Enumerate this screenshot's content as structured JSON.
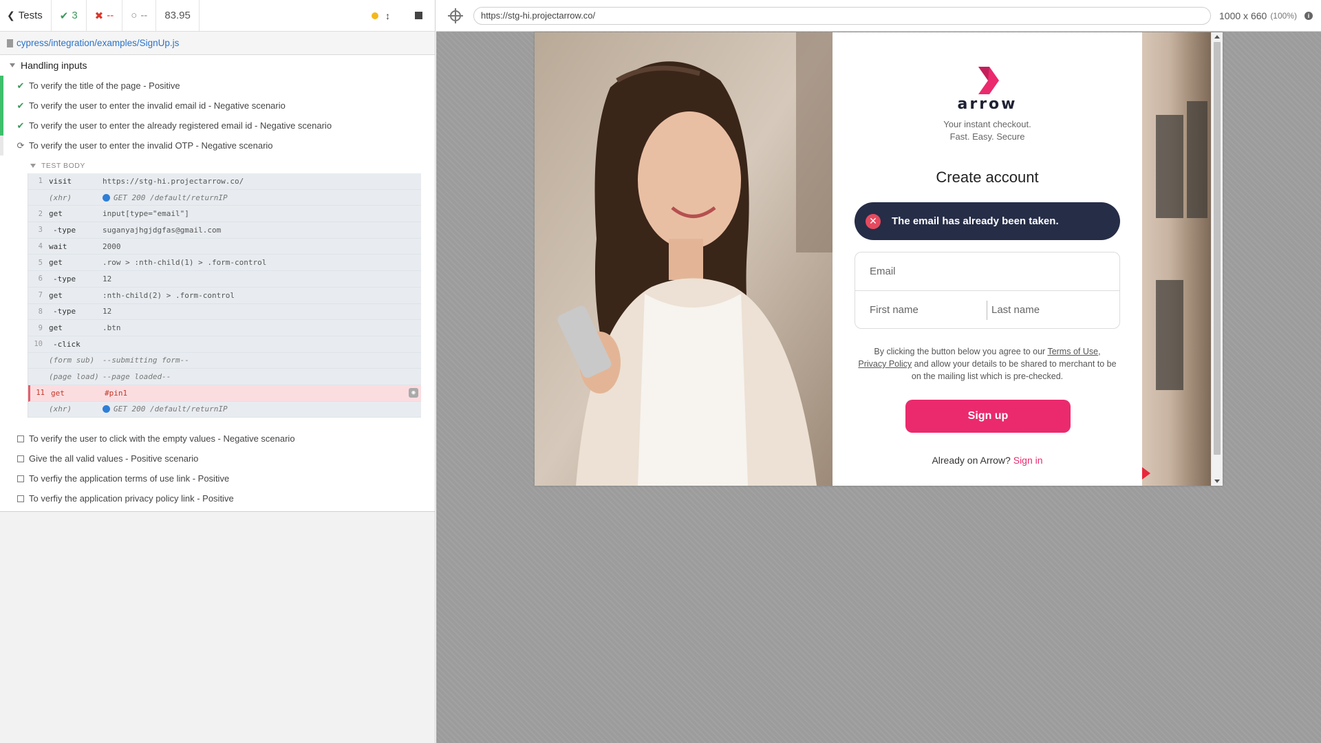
{
  "reporter": {
    "header": {
      "tests_label": "Tests",
      "passed": "3",
      "failed": "--",
      "pending": "--",
      "duration": "83.95"
    },
    "spec_path": "cypress/integration/examples/SignUp.js",
    "suite_title": "Handling inputs",
    "tests": [
      {
        "title": "To verify the title of the page - Positive",
        "state": "passed"
      },
      {
        "title": "To verify the user to enter the invalid email id - Negative scenario",
        "state": "passed"
      },
      {
        "title": "To verify the user to enter the already registered email id - Negative scenario",
        "state": "passed"
      },
      {
        "title": "To verify the user to enter the invalid OTP - Negative scenario",
        "state": "running"
      }
    ],
    "test_body_label": "TEST BODY",
    "commands": [
      {
        "num": "1",
        "name": "visit",
        "msg": "https://stg-hi.projectarrow.co/"
      },
      {
        "num": "",
        "name": "(xhr)",
        "msg": "GET 200 /default/returnIP"
      },
      {
        "num": "2",
        "name": "get",
        "msg": "input[type=\"email\"]"
      },
      {
        "num": "3",
        "name": "-type",
        "msg": "suganyajhgjdgfas@gmail.com"
      },
      {
        "num": "4",
        "name": "wait",
        "msg": "2000"
      },
      {
        "num": "5",
        "name": "get",
        "msg": ".row > :nth-child(1) > .form-control"
      },
      {
        "num": "6",
        "name": "-type",
        "msg": "12"
      },
      {
        "num": "7",
        "name": "get",
        "msg": ":nth-child(2) > .form-control"
      },
      {
        "num": "8",
        "name": "-type",
        "msg": "12"
      },
      {
        "num": "9",
        "name": "get",
        "msg": ".btn"
      },
      {
        "num": "10",
        "name": "-click",
        "msg": ""
      },
      {
        "num": "",
        "name": "(form sub)",
        "msg": "--submitting form--"
      },
      {
        "num": "",
        "name": "(page load)",
        "msg": "--page loaded--"
      },
      {
        "num": "11",
        "name": "get",
        "msg": "#pin1"
      },
      {
        "num": "",
        "name": "(xhr)",
        "msg": "GET 200 /default/returnIP"
      }
    ],
    "pending_tests": [
      {
        "title": "To verify the user to click with the empty values - Negative scenario"
      },
      {
        "title": "Give the all valid values - Positive scenario"
      },
      {
        "title": "To verfiy the application terms of use link - Positive"
      },
      {
        "title": "To verfiy the application privacy policy link - Positive"
      }
    ]
  },
  "aut": {
    "url": "https://stg-hi.projectarrow.co/",
    "viewport": "1000 x 660",
    "scale": "(100%)"
  },
  "app": {
    "logo_text": "arrow",
    "tagline_1": "Your instant checkout.",
    "tagline_2": "Fast. Easy. Secure",
    "title": "Create account",
    "alert": "The email has already been taken.",
    "email_placeholder": "Email",
    "first_name_placeholder": "First name",
    "last_name_placeholder": "Last name",
    "consent_1": "By clicking the button below you agree to our ",
    "terms_link": "Terms of Use",
    "consent_2": ",",
    "privacy_link": "Privacy Policy",
    "consent_3": " and allow your details to be shared to merchant to be on the mailing list which is pre-checked.",
    "signup_button": "Sign up",
    "already_text": "Already on Arrow? ",
    "signin_link": "Sign in"
  },
  "colors": {
    "brand_pink": "#ea2a6d",
    "alert_bg": "#262d47",
    "pass_green": "#3fbf6b",
    "fail_red": "#e25f6d"
  }
}
